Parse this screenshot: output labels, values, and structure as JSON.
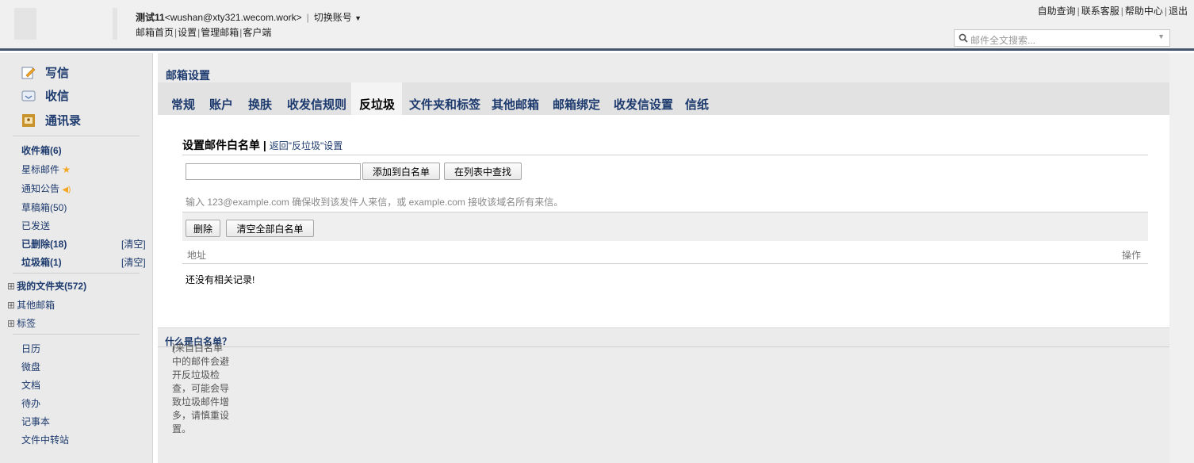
{
  "header": {
    "account_name": "测试11",
    "account_email": "<wushan@xty321.wecom.work>",
    "separator": "|",
    "switch_account": "切换账号",
    "nav": [
      "邮箱首页",
      "设置",
      "管理邮箱",
      "客户端"
    ],
    "nav_separator": "|",
    "top_links": [
      "自助查询",
      "联系客服",
      "帮助中心",
      "退出"
    ],
    "search_placeholder": "邮件全文搜索..."
  },
  "sidebar": {
    "compose": "写信",
    "inbox_action": "收信",
    "contacts": "通讯录",
    "folders": [
      {
        "label": "收件箱(6)",
        "bold": true
      },
      {
        "label": "星标邮件",
        "bold": false
      },
      {
        "label": "通知公告",
        "bold": false
      },
      {
        "label": "草稿箱(50)",
        "bold": false
      },
      {
        "label": "已发送",
        "bold": false
      },
      {
        "label": "已删除(18)",
        "bold": true,
        "clear": "[清空]"
      },
      {
        "label": "垃圾箱(1)",
        "bold": true,
        "clear": "[清空]"
      }
    ],
    "groups": [
      {
        "label": "我的文件夹(572)",
        "bold": true
      },
      {
        "label": "其他邮箱",
        "bold": false
      },
      {
        "label": "标签",
        "bold": false
      }
    ],
    "apps": [
      "日历",
      "微盘",
      "文档",
      "待办",
      "记事本",
      "文件中转站"
    ]
  },
  "main": {
    "page_title": "邮箱设置",
    "tabs": [
      "常规",
      "账户",
      "换肤",
      "收发信规则",
      "反垃圾",
      "文件夹和标签",
      "其他邮箱",
      "邮箱绑定",
      "收发信设置",
      "信纸"
    ],
    "active_tab": "反垃圾",
    "section_title": "设置邮件白名单",
    "section_sep": "|",
    "back_link": "返回\"反垃圾\"设置",
    "input_value": "",
    "add_button": "添加到白名单",
    "find_button": "在列表中查找",
    "hint": "输入 123@example.com 确保收到该发件人来信，或 example.com 接收该域名所有来信。",
    "delete_button": "删除",
    "clear_all_button": "清空全部白名单",
    "col_address": "地址",
    "col_actions": "操作",
    "empty_text": "还没有相关记录!",
    "footer_note": "(来自白名单中的邮件会避开反垃圾检查，可能会导致垃圾邮件增多，请慎重设置。",
    "footer_link": "什么是白名单？",
    "footer_end": ")"
  }
}
